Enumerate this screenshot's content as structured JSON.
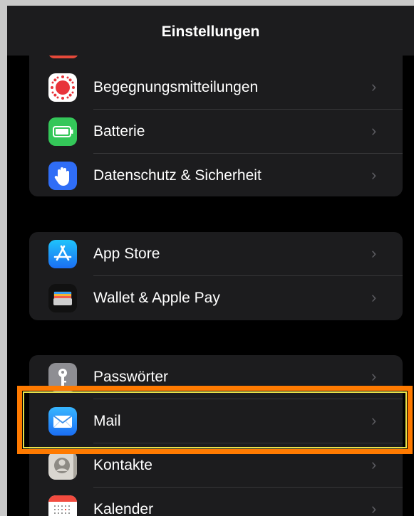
{
  "navbar": {
    "title": "Einstellungen"
  },
  "group1": [
    {
      "label": "Begegnungsmitteilungen",
      "icon": "exposure-notification-icon"
    },
    {
      "label": "Batterie",
      "icon": "battery-icon"
    },
    {
      "label": "Datenschutz & Sicherheit",
      "icon": "privacy-hand-icon"
    }
  ],
  "group2": [
    {
      "label": "App Store",
      "icon": "app-store-icon"
    },
    {
      "label": "Wallet & Apple Pay",
      "icon": "wallet-icon"
    }
  ],
  "group3": [
    {
      "label": "Passwörter",
      "icon": "key-icon"
    },
    {
      "label": "Mail",
      "icon": "mail-icon",
      "highlighted": true
    },
    {
      "label": "Kontakte",
      "icon": "contacts-icon"
    },
    {
      "label": "Kalender",
      "icon": "calendar-icon"
    }
  ],
  "chevron": "›",
  "colors": {
    "highlight_border": "#ff7a00",
    "highlight_inner": "#e8e14a",
    "background": "#000000",
    "group": "#1c1c1e"
  }
}
